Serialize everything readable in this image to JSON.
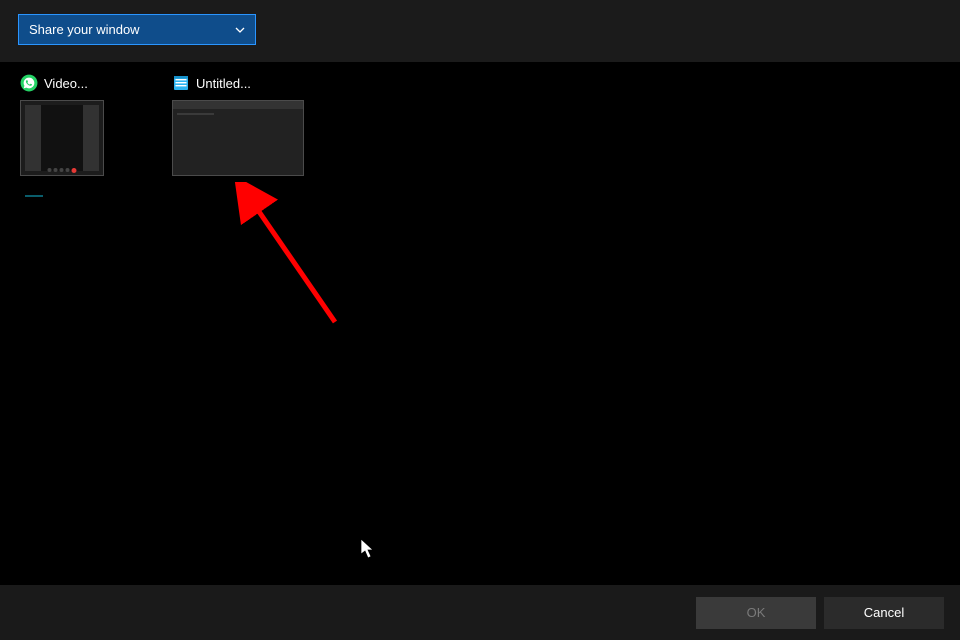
{
  "topbar": {
    "dropdown_label": "Share your window"
  },
  "windows": [
    {
      "label": "Video...",
      "icon": "whatsapp-icon",
      "thumb_kind": "call"
    },
    {
      "label": "Untitled...",
      "icon": "notepad-icon",
      "thumb_kind": "editor"
    }
  ],
  "footer": {
    "ok_label": "OK",
    "cancel_label": "Cancel"
  },
  "annotation": {
    "arrow_color": "#ff0000"
  }
}
